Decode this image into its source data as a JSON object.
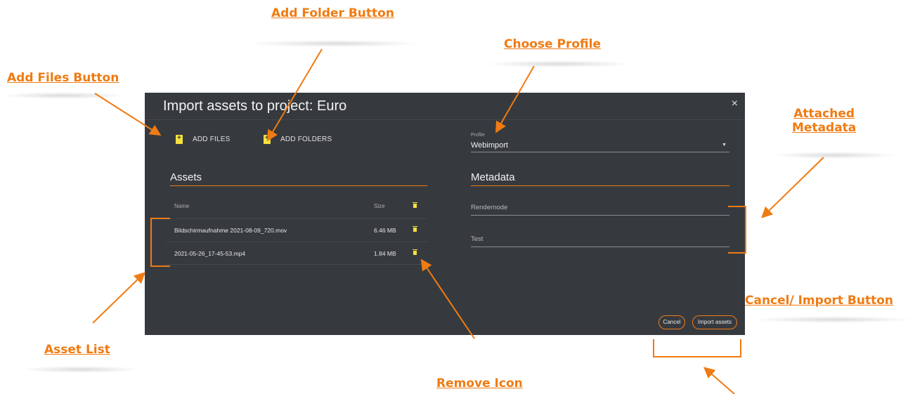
{
  "callouts": {
    "add_folder": "Add Folder Button",
    "choose_profile": "Choose Profile",
    "add_files": "Add Files Button",
    "attached_metadata_1": "Attached",
    "attached_metadata_2": "Metadata",
    "cancel_import": "Cancel/ Import Button",
    "asset_list": "Asset List",
    "remove_icon": "Remove Icon"
  },
  "dialog": {
    "title": "Import assets to project: Euro",
    "close_icon": "×",
    "add_files_label": "ADD FILES",
    "add_folders_label": "ADD FOLDERS"
  },
  "assets": {
    "title": "Assets",
    "col_name": "Name",
    "col_size": "Size",
    "rows": [
      {
        "name": "Bildschirmaufnahme 2021-08-09_720.mov",
        "size": "6.46 MB"
      },
      {
        "name": "2021-05-26_17-45-53.mp4",
        "size": "1.84 MB"
      }
    ]
  },
  "profile": {
    "label": "Profile",
    "value": "Webimport",
    "caret": "▼"
  },
  "metadata": {
    "title": "Metadata",
    "fields": [
      "Rendernode",
      "Test"
    ]
  },
  "actions": {
    "cancel": "Cancel",
    "import": "Import assets"
  },
  "colors": {
    "accent": "#f07b12",
    "dialog_bg": "#363a3f",
    "icon_yellow": "#f4e23e"
  },
  "icons": [
    "add-file-icon",
    "add-folder-icon",
    "trash-icon",
    "close-icon",
    "dropdown-caret-icon"
  ]
}
